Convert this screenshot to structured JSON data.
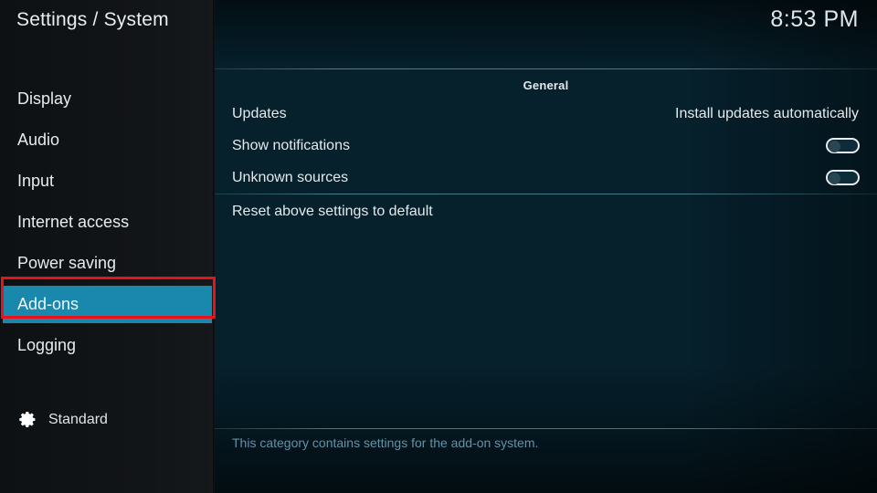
{
  "header": {
    "title": "Settings / System",
    "clock": "8:53 PM"
  },
  "sidebar": {
    "items": [
      {
        "label": "Display",
        "selected": false
      },
      {
        "label": "Audio",
        "selected": false
      },
      {
        "label": "Input",
        "selected": false
      },
      {
        "label": "Internet access",
        "selected": false
      },
      {
        "label": "Power saving",
        "selected": false
      },
      {
        "label": "Add-ons",
        "selected": true
      },
      {
        "label": "Logging",
        "selected": false
      }
    ],
    "profile": {
      "icon": "gear-icon",
      "label": "Standard"
    }
  },
  "main": {
    "group_title": "General",
    "rows": [
      {
        "label": "Updates",
        "value": "Install updates automatically",
        "type": "value"
      },
      {
        "label": "Show notifications",
        "value": "off",
        "type": "toggle"
      },
      {
        "label": "Unknown sources",
        "value": "off",
        "type": "toggle"
      },
      {
        "label": "Reset above settings to default",
        "value": "",
        "type": "action"
      }
    ],
    "description": "This category contains settings for the add-on system."
  },
  "annotation": {
    "target": "Add-ons",
    "color": "#e8121b"
  },
  "colors": {
    "highlight": "#1a87ad",
    "annotation": "#e8121b",
    "sidebar_bg": "#121517",
    "description_text": "#5f93ab"
  }
}
